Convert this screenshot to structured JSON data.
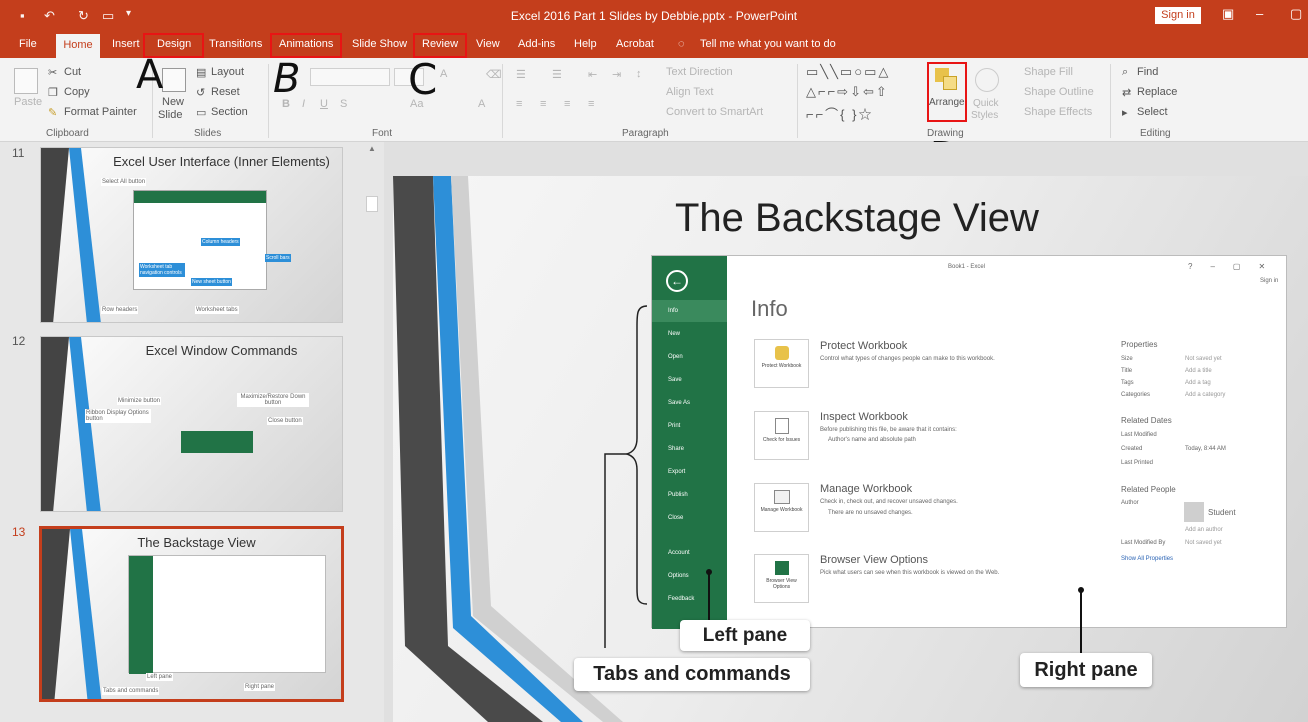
{
  "window": {
    "title": "Excel 2016 Part 1 Slides by Debbie.pptx - PowerPoint",
    "signin": "Sign in"
  },
  "tabs": [
    "File",
    "Home",
    "Insert",
    "Design",
    "Transitions",
    "Animations",
    "Slide Show",
    "Review",
    "View",
    "Add-ins",
    "Help",
    "Acrobat",
    "Tell me what you want to do"
  ],
  "ribbon": {
    "clipboard": {
      "paste": "Paste",
      "cut": "Cut",
      "copy": "Copy",
      "format_painter": "Format Painter",
      "group": "Clipboard"
    },
    "slides": {
      "new_slide": "New",
      "new_slide2": "Slide",
      "layout": "Layout",
      "reset": "Reset",
      "section": "Section",
      "group": "Slides"
    },
    "font": {
      "bold": "B",
      "italic": "I",
      "underline": "U",
      "strike": "S",
      "aa": "Aa",
      "a": "A",
      "group": "Font"
    },
    "paragraph": {
      "text_direction": "Text Direction",
      "align_text": "Align Text",
      "convert": "Convert to SmartArt",
      "group": "Paragraph"
    },
    "drawing": {
      "arrange": "Arrange",
      "quick_styles": "Quick",
      "quick_styles2": "Styles",
      "shape_fill": "Shape Fill",
      "shape_outline": "Shape Outline",
      "shape_effects": "Shape Effects",
      "group": "Drawing"
    },
    "editing": {
      "find": "Find",
      "replace": "Replace",
      "select": "Select",
      "group": "Editing"
    }
  },
  "annotations": {
    "a": "A",
    "b": "B",
    "c": "C",
    "d": "D"
  },
  "thumbnails": [
    {
      "num": "11",
      "title": "Excel User Interface (Inner Elements)",
      "labels": [
        "Select All button",
        "Column headers",
        "Worksheet tab navigation controls",
        "New sheet button",
        "Scroll bars",
        "Row headers",
        "Worksheet tabs"
      ]
    },
    {
      "num": "12",
      "title": "Excel Window Commands",
      "labels": [
        "Minimize button",
        "Maximize/Restore Down button",
        "Ribbon Display Options button",
        "Close button"
      ]
    },
    {
      "num": "13",
      "title": "The Backstage View",
      "labels": [
        "Left pane",
        "Tabs and commands",
        "Right pane"
      ]
    }
  ],
  "slide": {
    "title": "The Backstage View",
    "excel_title": "Book1 - Excel",
    "signin": "Sign in",
    "info_heading": "Info",
    "left_items": [
      "Info",
      "New",
      "Open",
      "Save",
      "Save As",
      "Print",
      "Share",
      "Export",
      "Publish",
      "Close",
      "Account",
      "Options",
      "Feedback"
    ],
    "sections": [
      {
        "btn": "Protect Workbook",
        "title": "Protect Workbook",
        "desc": "Control what types of changes people can make to this workbook."
      },
      {
        "btn": "Check for Issues",
        "title": "Inspect Workbook",
        "desc": "Before publishing this file, be aware that it contains:",
        "sub": "Author's name and absolute path"
      },
      {
        "btn": "Manage Workbook",
        "title": "Manage Workbook",
        "desc": "Check in, check out, and recover unsaved changes.",
        "sub": "There are no unsaved changes."
      },
      {
        "btn": "Browser View Options",
        "title": "Browser View Options",
        "desc": "Pick what users can see when this workbook is viewed on the Web."
      }
    ],
    "properties": {
      "heading": "Properties",
      "rows": [
        [
          "Size",
          "Not saved yet"
        ],
        [
          "Title",
          "Add a title"
        ],
        [
          "Tags",
          "Add a tag"
        ],
        [
          "Categories",
          "Add a category"
        ]
      ],
      "dates_heading": "Related Dates",
      "dates": [
        [
          "Last Modified",
          ""
        ],
        [
          "Created",
          "Today, 8:44 AM"
        ],
        [
          "Last Printed",
          ""
        ]
      ],
      "people_heading": "Related People",
      "author_label": "Author",
      "author": "Student",
      "add_author": "Add an author",
      "last_modified_by": "Last Modified By",
      "not_saved": "Not saved yet",
      "show_all": "Show All Properties"
    },
    "callouts": {
      "left_pane": "Left pane",
      "tabs_commands": "Tabs and commands",
      "right_pane": "Right pane"
    }
  },
  "colors": {
    "accent": "#c43e1c",
    "excel_green": "#217346",
    "highlight": "#e81414"
  }
}
